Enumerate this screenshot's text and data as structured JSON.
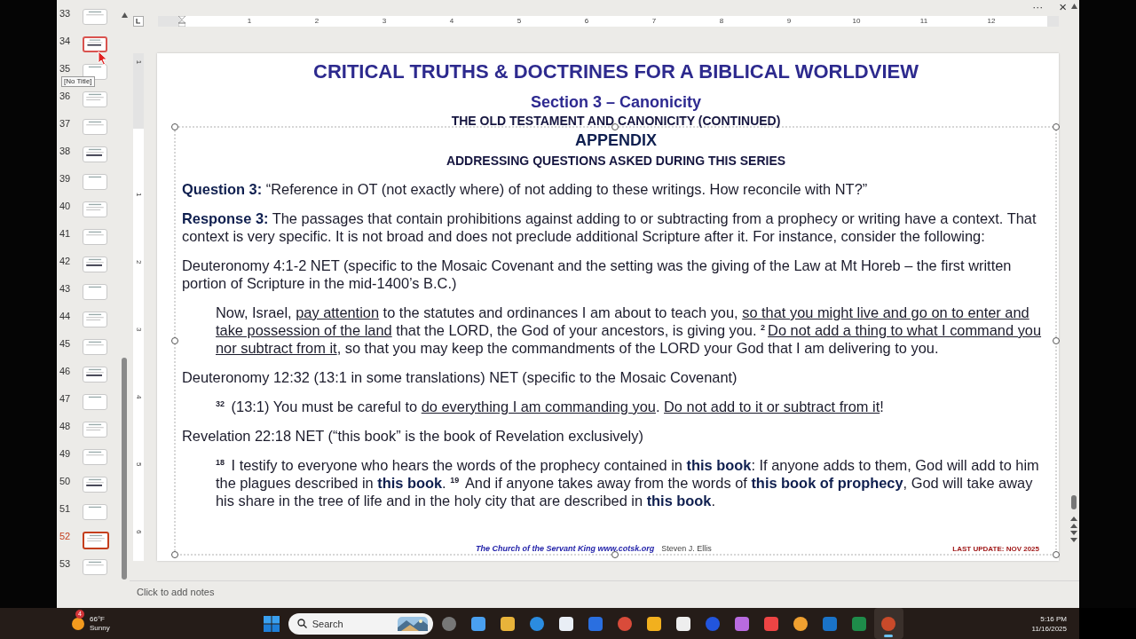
{
  "window": {
    "menu": "···",
    "close": "×"
  },
  "thumbnails": [
    {
      "number": "33",
      "selected": false,
      "hovered": false
    },
    {
      "number": "34",
      "selected": false,
      "hovered": true
    },
    {
      "number": "35",
      "selected": false,
      "hovered": false
    },
    {
      "number": "36",
      "selected": false,
      "hovered": false
    },
    {
      "number": "37",
      "selected": false,
      "hovered": false
    },
    {
      "number": "38",
      "selected": false,
      "hovered": false
    },
    {
      "number": "39",
      "selected": false,
      "hovered": false
    },
    {
      "number": "40",
      "selected": false,
      "hovered": false
    },
    {
      "number": "41",
      "selected": false,
      "hovered": false
    },
    {
      "number": "42",
      "selected": false,
      "hovered": false
    },
    {
      "number": "43",
      "selected": false,
      "hovered": false
    },
    {
      "number": "44",
      "selected": false,
      "hovered": false
    },
    {
      "number": "45",
      "selected": false,
      "hovered": false
    },
    {
      "number": "46",
      "selected": false,
      "hovered": false
    },
    {
      "number": "47",
      "selected": false,
      "hovered": false
    },
    {
      "number": "48",
      "selected": false,
      "hovered": false
    },
    {
      "number": "49",
      "selected": false,
      "hovered": false
    },
    {
      "number": "50",
      "selected": false,
      "hovered": false
    },
    {
      "number": "51",
      "selected": false,
      "hovered": false
    },
    {
      "number": "52",
      "selected": true,
      "hovered": false
    },
    {
      "number": "53",
      "selected": false,
      "hovered": false
    }
  ],
  "tooltip": "[No Title]",
  "ruler": {
    "horizontal": [
      "1",
      "2",
      "3",
      "4",
      "5",
      "6",
      "7",
      "8",
      "9",
      "10",
      "11",
      "12"
    ],
    "vertical": [
      "1",
      "1",
      "2",
      "3",
      "4",
      "5",
      "6"
    ]
  },
  "slide": {
    "title": "CRITICAL TRUTHS & DOCTRINES FOR A BIBLICAL WORLDVIEW",
    "section": "Section 3 – Canonicity",
    "subtitle": "THE OLD TESTAMENT AND CANONICITY (CONTINUED)",
    "heading": "APPENDIX",
    "subheading": "ADDRESSING QUESTIONS ASKED DURING THIS SERIES",
    "blocks": [
      {
        "kind": "para",
        "segments": [
          {
            "kind": "bold",
            "text": "Question 3:"
          },
          {
            "kind": "plain",
            "text": "  “Reference in OT (not exactly where) of not adding to these writings. How reconcile with NT?”"
          }
        ]
      },
      {
        "kind": "para",
        "segments": [
          {
            "kind": "bold",
            "text": "Response 3:"
          },
          {
            "kind": "plain",
            "text": "  The passages that contain prohibitions against adding to or subtracting from a prophecy or writing have a context. That context is very specific.  It is not broad and does not preclude additional Scripture after it.  For instance, consider the following:"
          }
        ]
      },
      {
        "kind": "para",
        "segments": [
          {
            "kind": "plain",
            "text": "Deuteronomy 4:1-2 NET (specific to the Mosaic Covenant and the setting was the giving of the Law at Mt Horeb – the first written portion of Scripture in the mid-1400’s B.C.)"
          }
        ]
      },
      {
        "kind": "quote",
        "segments": [
          {
            "kind": "plain",
            "text": "Now, Israel, "
          },
          {
            "kind": "underline",
            "text": "pay attention"
          },
          {
            "kind": "plain",
            "text": " to the statutes and ordinances I am about to teach you, "
          },
          {
            "kind": "underline",
            "text": "so that you might live and go on to enter and take possession of the land"
          },
          {
            "kind": "plain",
            "text": " that the LORD, the God of your ancestors, is giving you. "
          },
          {
            "kind": "sup",
            "text": "2"
          },
          {
            "kind": "underline",
            "text": "Do not add a thing to what I command you nor subtract from it"
          },
          {
            "kind": "plain",
            "text": ", so that you may keep the commandments of the LORD your God that I am delivering to you."
          }
        ]
      },
      {
        "kind": "para",
        "segments": [
          {
            "kind": "plain",
            "text": "Deuteronomy 12:32 (13:1 in some translations) NET (specific to the Mosaic Covenant)"
          }
        ]
      },
      {
        "kind": "quote",
        "segments": [
          {
            "kind": "sup",
            "text": "32"
          },
          {
            "kind": "plain",
            "text": " (13:1) You must be careful to "
          },
          {
            "kind": "underline",
            "text": "do everything I am commanding you"
          },
          {
            "kind": "plain",
            "text": ". "
          },
          {
            "kind": "underline",
            "text": "Do not add to it or subtract from it"
          },
          {
            "kind": "plain",
            "text": "!"
          }
        ]
      },
      {
        "kind": "para",
        "segments": [
          {
            "kind": "plain",
            "text": "Revelation 22:18 NET (“this book” is the book of Revelation exclusively)"
          }
        ]
      },
      {
        "kind": "quote",
        "segments": [
          {
            "kind": "sup",
            "text": "18"
          },
          {
            "kind": "plain",
            "text": " I testify to everyone who hears the words of the prophecy contained in "
          },
          {
            "kind": "bold",
            "text": "this book"
          },
          {
            "kind": "plain",
            "text": ": If anyone adds to them, God will add to him the plagues described in "
          },
          {
            "kind": "bold",
            "text": "this book"
          },
          {
            "kind": "plain",
            "text": ". "
          },
          {
            "kind": "sup",
            "text": "19"
          },
          {
            "kind": "plain",
            "text": " And if anyone takes away from the words of "
          },
          {
            "kind": "bold",
            "text": "this book of prophecy"
          },
          {
            "kind": "plain",
            "text": ", God will take away his share in the tree of life and in the holy city that are described in "
          },
          {
            "kind": "bold",
            "text": "this book"
          },
          {
            "kind": "plain",
            "text": "."
          }
        ]
      }
    ],
    "footer": {
      "church": "The Church of the Servant King  www.cotsk.org",
      "author": "Steven J. Ellis",
      "update": "LAST UPDATE:  NOV 2025"
    }
  },
  "notes": {
    "placeholder": "Click to add notes"
  },
  "taskbar": {
    "weather": {
      "badge": "4",
      "temperature": "66°F",
      "condition": "Sunny"
    },
    "search": {
      "placeholder": "Search"
    },
    "apps": [
      {
        "active": false
      },
      {
        "active": false
      },
      {
        "active": false
      },
      {
        "active": false
      },
      {
        "active": false
      },
      {
        "active": false
      },
      {
        "active": false
      },
      {
        "active": false
      },
      {
        "active": false
      },
      {
        "active": false
      },
      {
        "active": false
      },
      {
        "active": false
      },
      {
        "active": false
      },
      {
        "active": false
      },
      {
        "active": false
      },
      {
        "active": true
      }
    ],
    "time": "5:16 PM",
    "date": "11/16/2025"
  }
}
